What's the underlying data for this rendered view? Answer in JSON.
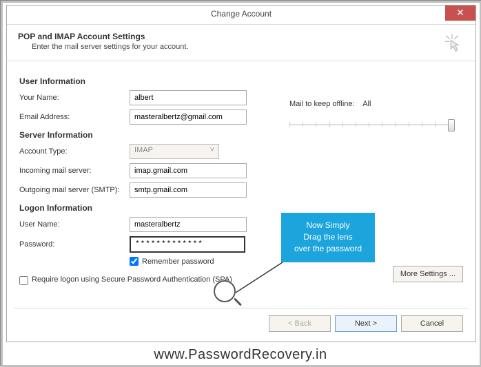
{
  "window": {
    "title": "Change Account"
  },
  "header": {
    "title": "POP and IMAP Account Settings",
    "subtitle": "Enter the mail server settings for your account."
  },
  "sections": {
    "user_info": "User Information",
    "server_info": "Server Information",
    "logon_info": "Logon Information"
  },
  "labels": {
    "your_name": "Your Name:",
    "email": "Email Address:",
    "account_type": "Account Type:",
    "incoming": "Incoming mail server:",
    "outgoing": "Outgoing mail server (SMTP):",
    "username": "User Name:",
    "password": "Password:",
    "remember": "Remember password",
    "spa": "Require logon using Secure Password Authentication (SPA)",
    "mail_keep": "Mail to keep offline:",
    "mail_keep_val": "All"
  },
  "values": {
    "your_name": "albert",
    "email": "masteralbertz@gmail.com",
    "account_type": "IMAP",
    "incoming": "imap.gmail.com",
    "outgoing": "smtp.gmail.com",
    "username": "masteralbertz",
    "password": "*************"
  },
  "buttons": {
    "more_settings": "More Settings ...",
    "back": "< Back",
    "next": "Next >",
    "cancel": "Cancel"
  },
  "callout": {
    "line1": "Now Simply",
    "line2": "Drag the lens",
    "line3": "over the password"
  },
  "watermark": "www.PasswordRecovery.in"
}
